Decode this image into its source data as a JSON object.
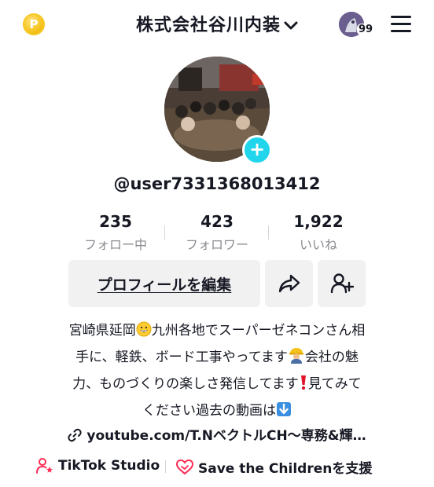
{
  "header": {
    "account_name": "株式会社谷川内装",
    "coin_icon": "coin-icon",
    "notification_count": "99",
    "menu_icon": "hamburger-menu-icon"
  },
  "profile": {
    "username": "@user7331368013412"
  },
  "stats": [
    {
      "value": "235",
      "label": "フォロー中"
    },
    {
      "value": "423",
      "label": "フォロワー"
    },
    {
      "value": "1,922",
      "label": "いいね"
    }
  ],
  "actions": {
    "edit_profile": "プロフィールを編集"
  },
  "bio": {
    "line1a": "宮崎県延岡",
    "line1b": "九州各地でスーパーゼネコンさん相",
    "line2a": "手に、軽鉄、ボード工事やってます",
    "line2b": "会社の魅",
    "line3a": "力、ものづくりの楽しさ発信してます",
    "line3b": "見てみて",
    "line4": "ください過去の動画は"
  },
  "link": {
    "text": "youtube.com/T.NベクトルCH〜専務&輝…"
  },
  "footer": {
    "studio": "TikTok Studio",
    "charity": "Save the Childrenを支援"
  },
  "colors": {
    "accent_cyan": "#20d5ec",
    "pink": "#fe2c55",
    "text": "#161823",
    "muted": "#8a8b91",
    "button_bg": "#f1f1f2"
  }
}
